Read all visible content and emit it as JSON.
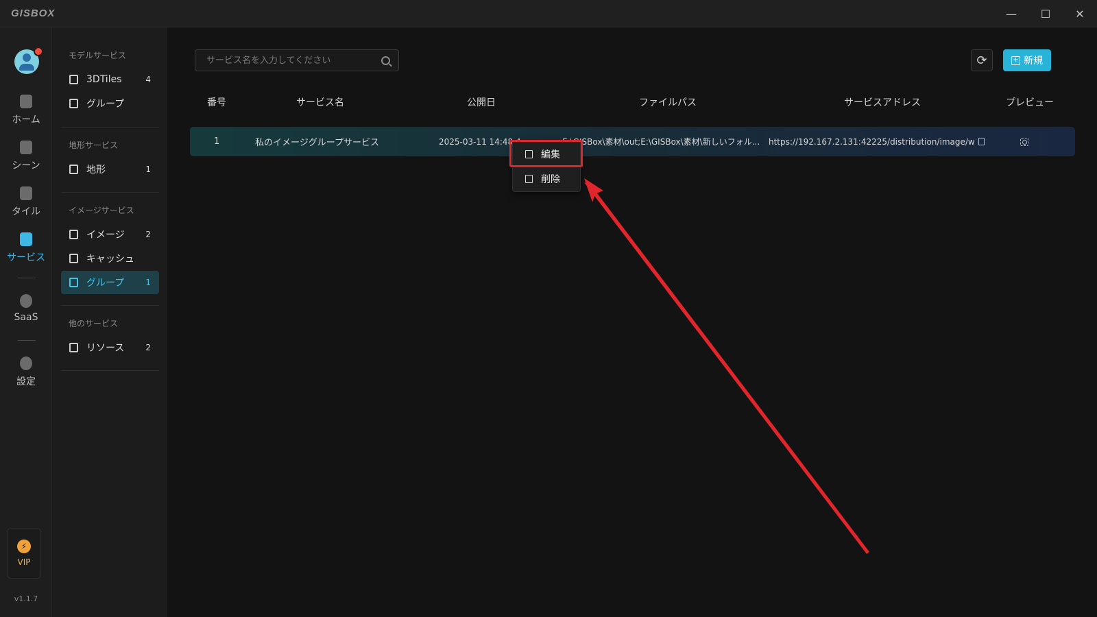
{
  "app": {
    "logo": "GISBOX"
  },
  "window_controls": {
    "minimize": "—",
    "maximize": "☐",
    "close": "✕"
  },
  "rail": {
    "items": [
      {
        "label": "ホーム",
        "icon": "home-icon"
      },
      {
        "label": "シーン",
        "icon": "scene-icon"
      },
      {
        "label": "タイル",
        "icon": "tile-icon"
      },
      {
        "label": "サービス",
        "icon": "service-icon",
        "active": true
      },
      {
        "label": "SaaS",
        "icon": "saas-icon"
      },
      {
        "label": "設定",
        "icon": "settings-icon"
      }
    ],
    "vip_label": "VIP",
    "version": "v1.1.7"
  },
  "categories": {
    "model": {
      "header": "モデルサービス",
      "items": [
        {
          "label": "3DTiles",
          "count": "4"
        },
        {
          "label": "グループ",
          "count": ""
        }
      ]
    },
    "terrain": {
      "header": "地形サービス",
      "items": [
        {
          "label": "地形",
          "count": "1"
        }
      ]
    },
    "image": {
      "header": "イメージサービス",
      "items": [
        {
          "label": "イメージ",
          "count": "2"
        },
        {
          "label": "キャッシュ",
          "count": ""
        },
        {
          "label": "グループ",
          "count": "1"
        }
      ]
    },
    "other": {
      "header": "他のサービス",
      "items": [
        {
          "label": "リソース",
          "count": "2"
        }
      ]
    }
  },
  "search": {
    "placeholder": "サービス名を入力してください",
    "value": ""
  },
  "toolbar": {
    "new_label": "新規"
  },
  "table": {
    "headers": [
      "番号",
      "サービス名",
      "公開日",
      "ファイルパス",
      "サービスアドレス",
      "プレビュー"
    ],
    "rows": [
      {
        "no": "1",
        "name": "私のイメージグループサービス",
        "date": "2025-03-11 14:48:4",
        "path": "E:\\GISBox\\素材\\out;E:\\GISBox\\素材\\新しいフォル...",
        "address": "https://192.167.2.131:42225/distribution/image/w..."
      }
    ]
  },
  "context_menu": {
    "edit": "編集",
    "delete": "削除"
  },
  "colors": {
    "accent": "#2ab3d9",
    "active_bg": "#1d4049",
    "annotation": "#e0262a"
  }
}
